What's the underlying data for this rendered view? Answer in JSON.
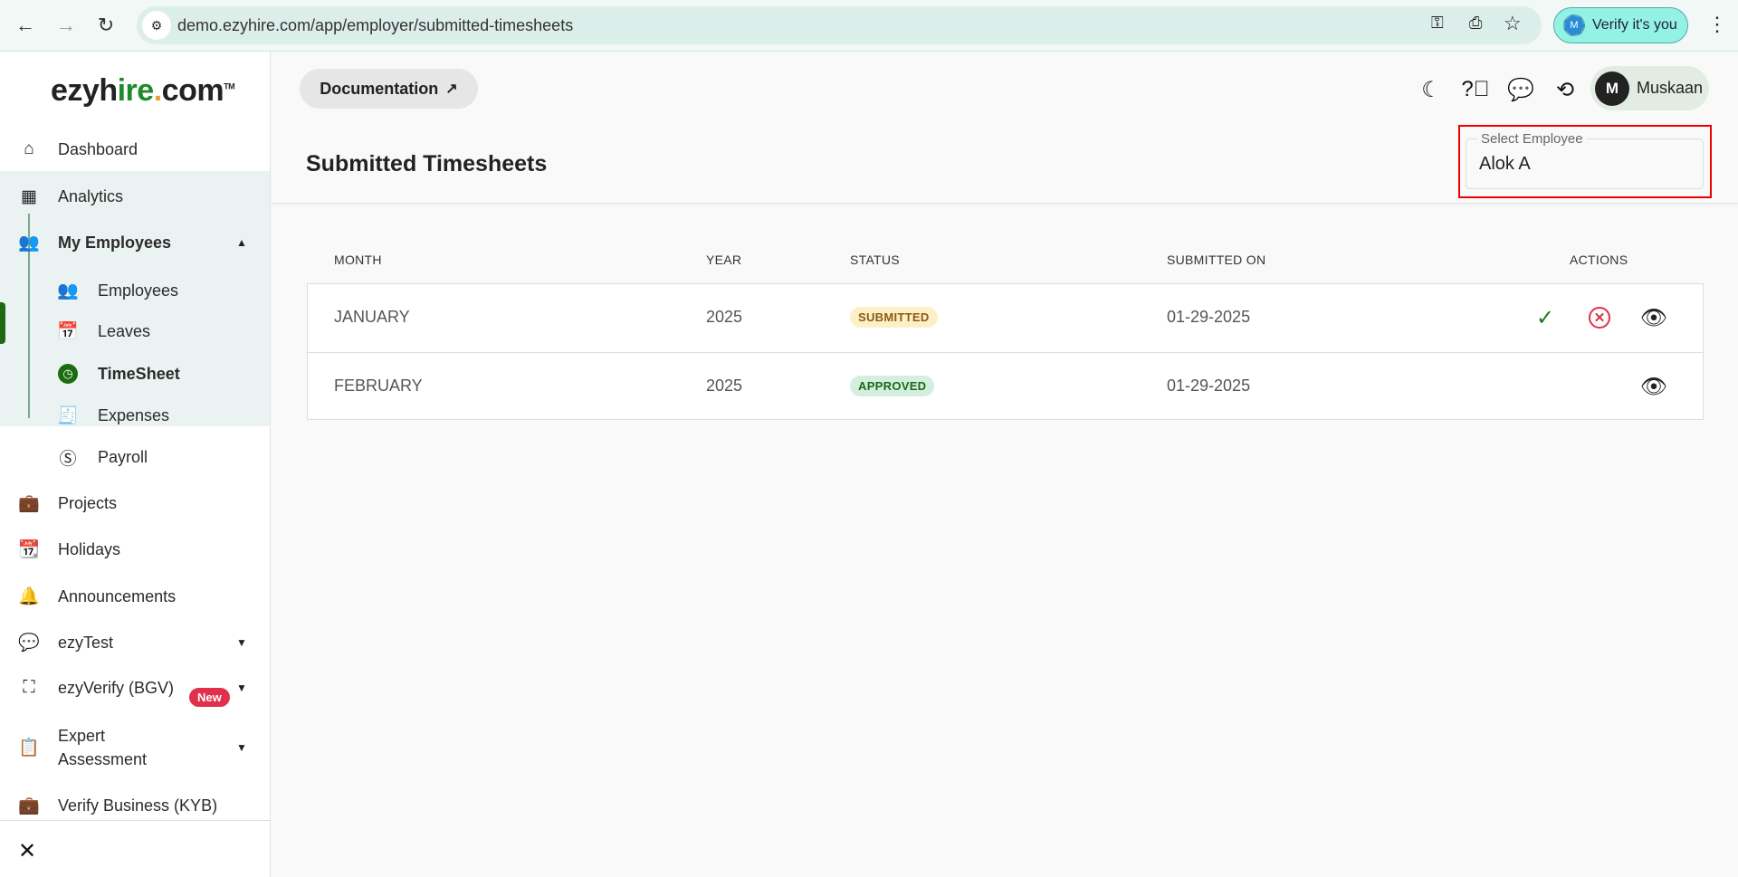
{
  "browser": {
    "url": "demo.ezyhire.com/app/employer/submitted-timesheets",
    "verify_label": "Verify it's you",
    "profile_initial": "M"
  },
  "logo": {
    "part1": "ezyh",
    "part2": "ir",
    "part3": "e",
    "part4": ".",
    "part5": "com",
    "tm": "TM"
  },
  "sidebar": {
    "items": [
      {
        "label": "Dashboard",
        "icon": "home-icon"
      },
      {
        "label": "Analytics",
        "icon": "analytics-icon"
      },
      {
        "label": "My Employees",
        "icon": "people-icon"
      },
      {
        "label": "Employees",
        "icon": "people-icon"
      },
      {
        "label": "Leaves",
        "icon": "calendar-x-icon"
      },
      {
        "label": "TimeSheet",
        "icon": "clock-icon"
      },
      {
        "label": "Expenses",
        "icon": "receipt-dollar-icon"
      },
      {
        "label": "Payroll",
        "icon": "dollar-circle-icon"
      },
      {
        "label": "Projects",
        "icon": "briefcase-clock-icon"
      },
      {
        "label": "Holidays",
        "icon": "calendar-icon"
      },
      {
        "label": "Announcements",
        "icon": "bell-icon"
      },
      {
        "label": "ezyTest",
        "icon": "chat-icon"
      },
      {
        "label": "ezyVerify (BGV)",
        "icon": "face-scan-icon"
      },
      {
        "label": "Expert",
        "label2": "Assessment",
        "icon": "clipboard-icon",
        "badge": "New"
      },
      {
        "label": "Verify Business (KYB)",
        "icon": "briefcase-icon"
      }
    ],
    "active": "TimeSheet",
    "accent": "#1c6b12"
  },
  "header": {
    "doc_label": "Documentation",
    "user_initial": "M",
    "user_name": "Muskaan"
  },
  "page": {
    "title": "Submitted Timesheets",
    "select_label": "Select Employee",
    "select_value": "Alok A"
  },
  "table": {
    "columns": [
      "MONTH",
      "YEAR",
      "STATUS",
      "SUBMITTED ON",
      "ACTIONS"
    ],
    "rows": [
      {
        "month": "JANUARY",
        "year": "2025",
        "status": "SUBMITTED",
        "submitted_on": "01-29-2025",
        "actions": [
          "approve",
          "reject",
          "view"
        ]
      },
      {
        "month": "FEBRUARY",
        "year": "2025",
        "status": "APPROVED",
        "submitted_on": "01-29-2025",
        "actions": [
          "view"
        ]
      }
    ]
  },
  "colors": {
    "submitted_bg": "#fdefc6",
    "submitted_fg": "#8a5a14",
    "approved_bg": "#d4eee0",
    "approved_fg": "#1c6b12",
    "reject": "#e0304b"
  }
}
